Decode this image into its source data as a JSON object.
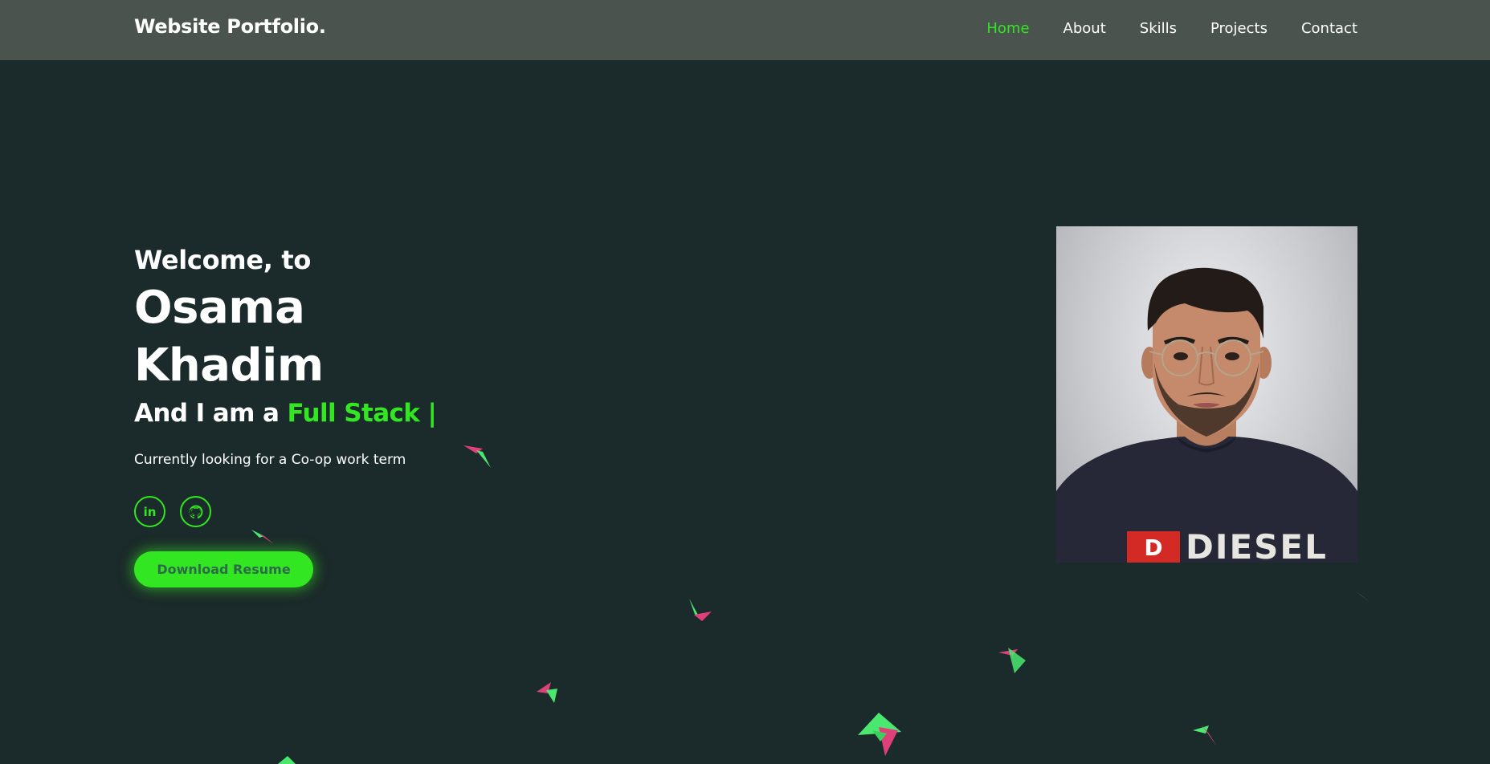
{
  "nav": {
    "brand": "Website Portfolio.",
    "links": [
      {
        "label": "Home",
        "active": true
      },
      {
        "label": "About",
        "active": false
      },
      {
        "label": "Skills",
        "active": false
      },
      {
        "label": "Projects",
        "active": false
      },
      {
        "label": "Contact",
        "active": false
      }
    ]
  },
  "hero": {
    "welcome": "Welcome, to",
    "first_name": "Osama",
    "last_name": "Khadim",
    "role_prefix": "And I am a",
    "role": "Full Stack |",
    "tagline": "Currently looking for a Co-op work term"
  },
  "socials": [
    {
      "icon": "linkedin-icon",
      "glyph": "in"
    },
    {
      "icon": "github-icon"
    }
  ],
  "download_label": "Download Resume",
  "portrait": {
    "shirt_text": "DIESEL",
    "logo_letter": "D"
  },
  "colors": {
    "accent": "#33e622",
    "background": "#1b2a2a",
    "navbar": "#4a534d",
    "bird_pink": "#e0407a",
    "bird_green": "#4be870"
  }
}
